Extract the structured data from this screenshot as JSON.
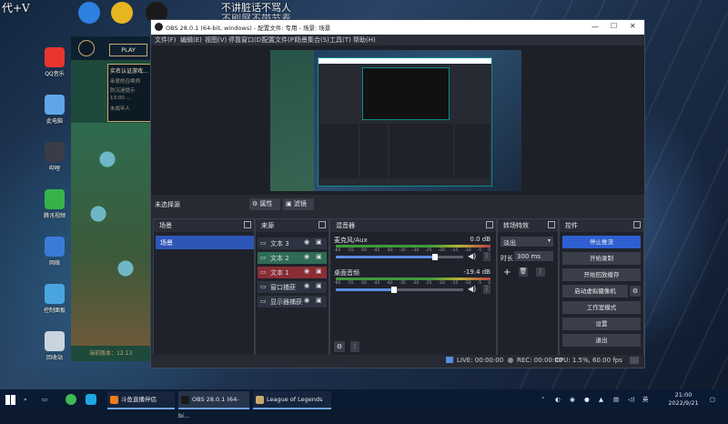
{
  "desktop": {
    "overlay_top_left": "代+V",
    "overlay_center_1": "不讲脏话不骂人",
    "overlay_center_2": "不刷屏不带节奏",
    "icons": [
      {
        "label": "QQ音乐",
        "color": "#e8352f"
      },
      {
        "label": "此电脑",
        "color": "#5ea6e6"
      },
      {
        "label": "哔哩",
        "color": "#3a3d47"
      },
      {
        "label": "腾讯视频",
        "color": "#35b34a"
      },
      {
        "label": "网络",
        "color": "#3b7bd8"
      },
      {
        "label": "控制面板",
        "color": "#4aa4e0"
      },
      {
        "label": "回收站",
        "color": "#c9d4df"
      }
    ],
    "top_icons": [
      {
        "name": "ie-icon",
        "color": "#2d7fe0"
      },
      {
        "name": "chrome-icon",
        "color": "#e6b51f"
      },
      {
        "name": "obs-icon",
        "color": "#1a1a1a"
      }
    ]
  },
  "game": {
    "play_label": "PLAY",
    "notice_title": "实名认证游戏...",
    "notice_lines": [
      "亲爱的召唤师",
      "防沉迷提示",
      "13:00 ...",
      "未成年人"
    ],
    "version": "当前版本：12.13",
    "accent": "#c8aa6e"
  },
  "obs": {
    "title": "OBS 28.0.1 (64-bit, windows) - 配置文件: 专用 - 场景: 场景",
    "menu": [
      "文件(F)",
      "编辑(E)",
      "视图(V)",
      "停靠窗口(D)",
      "配置文件(P)",
      "场景集合(S)",
      "工具(T)",
      "帮助(H)"
    ],
    "source_toolbar": {
      "no_source": "未选择源",
      "properties": "属性",
      "filters": "滤镜"
    },
    "scenes": {
      "title": "场景",
      "items": [
        "场景"
      ]
    },
    "sources": {
      "title": "来源",
      "items": [
        {
          "label": "文本 3",
          "style": "plain"
        },
        {
          "label": "文本 2",
          "style": "green"
        },
        {
          "label": "文本 1",
          "style": "red"
        },
        {
          "label": "窗口捕获",
          "style": "plain"
        },
        {
          "label": "显示器捕获",
          "style": "plain"
        }
      ]
    },
    "mixer": {
      "title": "混音器",
      "channels": [
        {
          "name": "麦克风/Aux",
          "db": "0.0 dB",
          "level": 0.78
        },
        {
          "name": "桌面音频",
          "db": "-19.4 dB",
          "level": 0.46
        }
      ],
      "scale": [
        "-60",
        "-55",
        "-50",
        "-45",
        "-40",
        "-35",
        "-30",
        "-25",
        "-20",
        "-15",
        "-10",
        "-5",
        "0"
      ]
    },
    "transitions": {
      "title": "转场特效",
      "type": "淡出",
      "duration_label": "时长",
      "duration_value": "300 ms"
    },
    "controls": {
      "title": "控件",
      "buttons": [
        "停止推流",
        "开始录制",
        "开始回放缓存",
        "启动虚拟摄像机",
        "工作室模式",
        "设置",
        "退出"
      ]
    },
    "status": {
      "live": "LIVE: 00:00:00",
      "rec": "REC: 00:00:00",
      "cpu": "CPU: 1.5%, 60.00 fps"
    }
  },
  "taskbar": {
    "apps": [
      {
        "label": "斗鱼直播伴侣",
        "color": "#f07b1d"
      },
      {
        "label": "OBS 28.0.1 (64-bi...",
        "color": "#1a1a1a"
      },
      {
        "label": "League of Legends",
        "color": "#c8aa6e"
      }
    ],
    "tray_lang": "英",
    "time": "21:00",
    "date": "2022/9/21"
  },
  "colors": {
    "obs_accent": "#2e55b8",
    "stop_button": "#2f5fd0",
    "green_source": "#2f6b55",
    "red_source": "#8a2d34"
  }
}
